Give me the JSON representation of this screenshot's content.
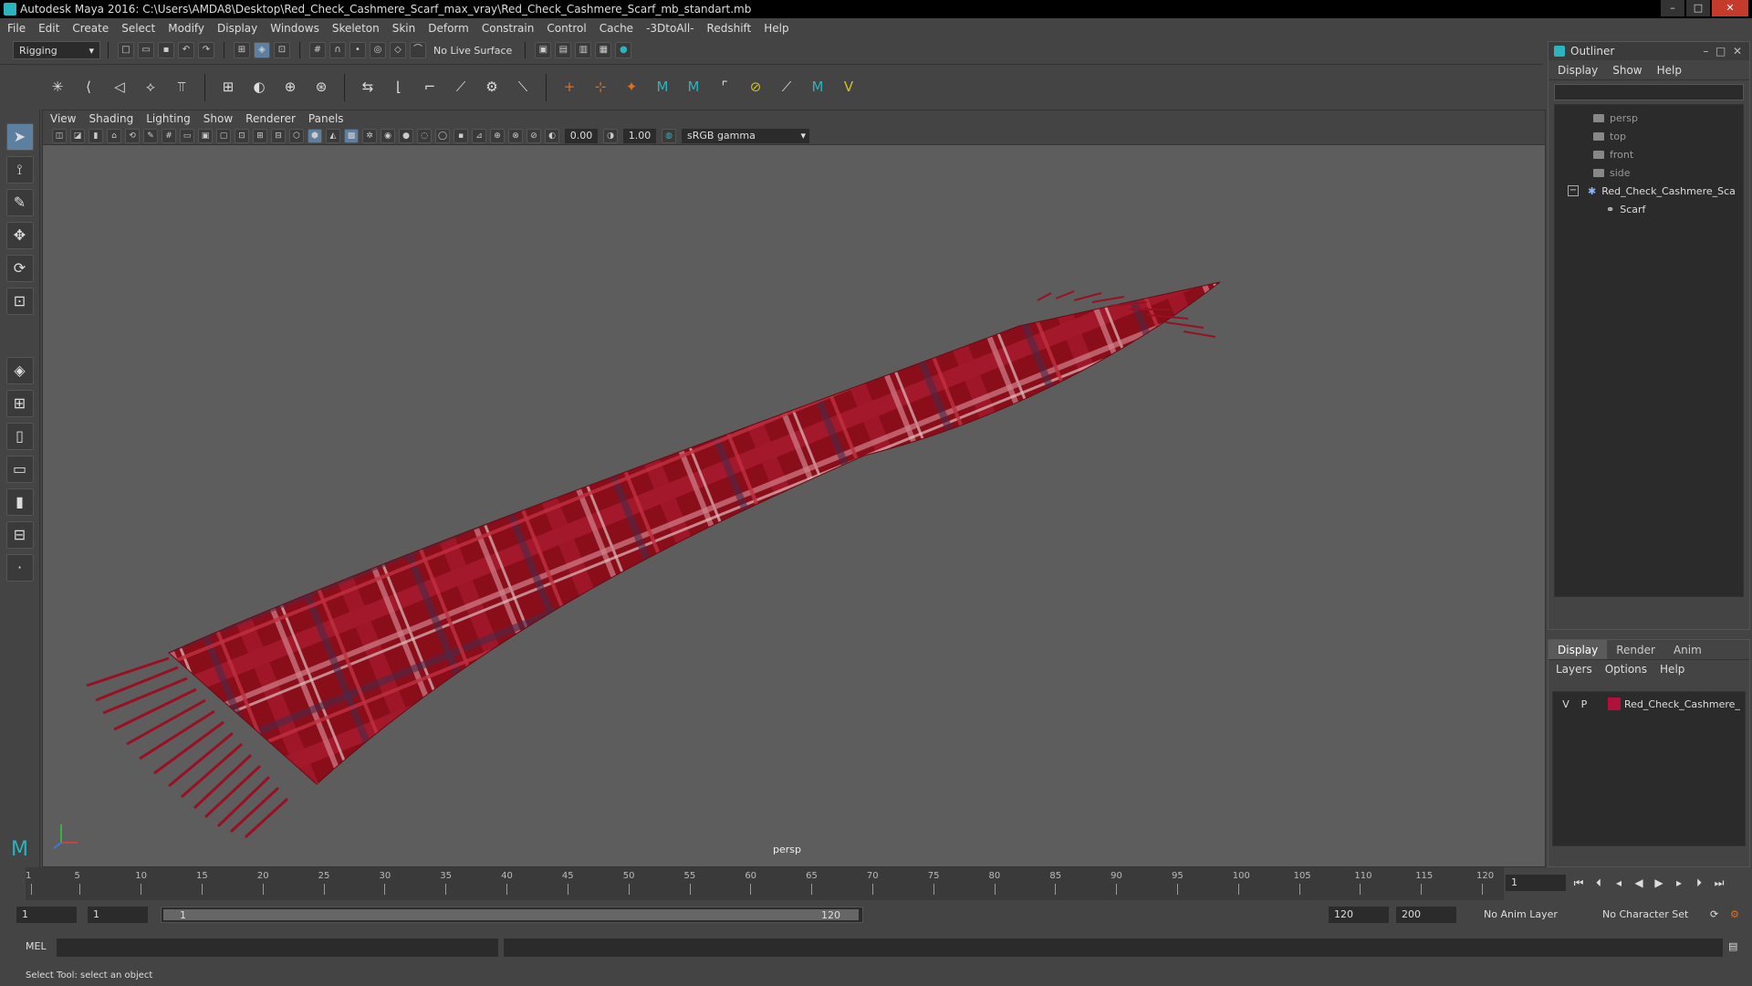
{
  "window": {
    "title": "Autodesk Maya 2016: C:\\Users\\AMDA8\\Desktop\\Red_Check_Cashmere_Scarf_max_vray\\Red_Check_Cashmere_Scarf_mb_standart.mb",
    "minimize": "–",
    "maximize": "□",
    "close": "✕"
  },
  "menubar": [
    "File",
    "Edit",
    "Create",
    "Select",
    "Modify",
    "Display",
    "Windows",
    "Skeleton",
    "Skin",
    "Deform",
    "Constrain",
    "Control",
    "Cache",
    "-3DtoAll-",
    "Redshift",
    "Help"
  ],
  "toolbar": {
    "menuset": "Rigging",
    "live_surface": "No Live Surface"
  },
  "viewport": {
    "menu": [
      "View",
      "Shading",
      "Lighting",
      "Show",
      "Renderer",
      "Panels"
    ],
    "exposure": "0.00",
    "gamma_value": "1.00",
    "color_space": "sRGB gamma",
    "camera_label": "persp"
  },
  "outliner": {
    "title": "Outliner",
    "menu": [
      "Display",
      "Show",
      "Help"
    ],
    "items": [
      "persp",
      "top",
      "front",
      "side",
      "Red_Check_Cashmere_Sca",
      "Scarf"
    ]
  },
  "layer_editor": {
    "tabs": [
      "Display",
      "Render",
      "Anim"
    ],
    "menu": [
      "Layers",
      "Options",
      "Help"
    ],
    "layer": {
      "v": "V",
      "p": "P",
      "name": "Red_Check_Cashmere_",
      "color": "#b0103a"
    }
  },
  "timeline": {
    "ticks": [
      "1",
      "5",
      "10",
      "15",
      "20",
      "25",
      "30",
      "35",
      "40",
      "45",
      "50",
      "55",
      "60",
      "65",
      "70",
      "75",
      "80",
      "85",
      "90",
      "95",
      "100",
      "105",
      "110",
      "115",
      "120"
    ],
    "current_frame": "1"
  },
  "range": {
    "start": "1",
    "playback_start": "1",
    "slider_start": "1",
    "slider_end": "120",
    "playback_end": "120",
    "end": "200",
    "anim_layer": "No Anim Layer",
    "character_set": "No Character Set"
  },
  "command_line": {
    "label": "MEL"
  },
  "status": {
    "message": "Select Tool: select an object"
  },
  "colors": {
    "scarf_base": "#8a0d1a",
    "scarf_check": "#c2223a",
    "accent": "#2bb3c0"
  }
}
